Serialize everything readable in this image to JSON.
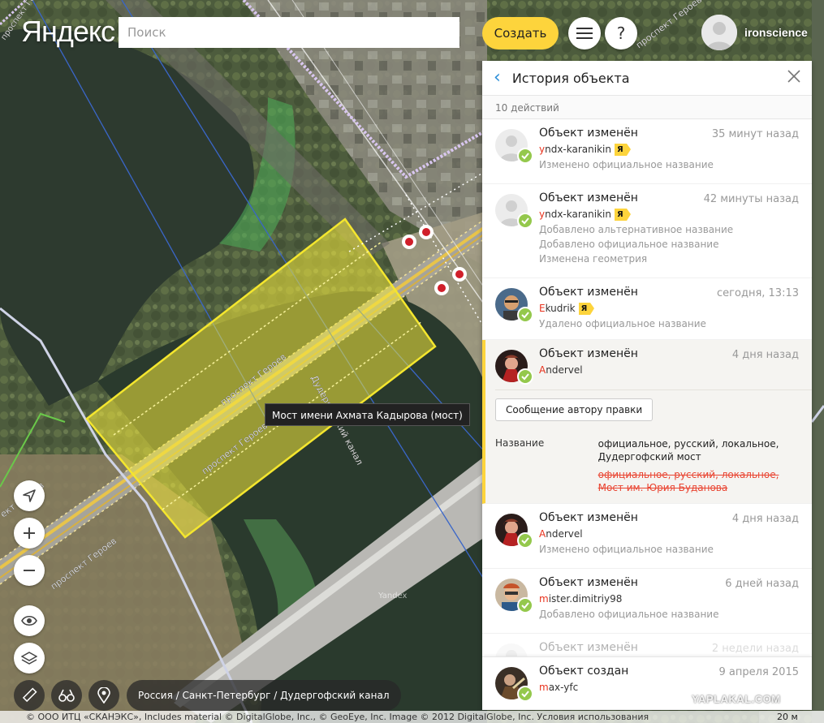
{
  "header": {
    "logo": "Яндекс",
    "search_placeholder": "Поиск",
    "create_label": "Создать",
    "help_label": "?",
    "username": "ironscience"
  },
  "map": {
    "tooltip": "Мост имени Ахмата Кадырова (мост)",
    "street_labels": [
      "проспект Героев",
      "проспект Героев",
      "проспект Героев",
      "проспект Героев",
      "ект Героев",
      "Дудергофский канал",
      "проспект Героев"
    ],
    "yandex_watermark": "Yandex",
    "breadcrumbs": "Россия / Санкт-Петербург / Дудергофский канал",
    "copyright": "© ООО ИТЦ «СКАНЭКС», Includes material © DigitalGlobe, Inc., © GeoEye, Inc. Image © 2012 DigitalGlobe, Inc. Условия использования",
    "scale": "20 м",
    "site_watermark": "YAPLAKAL.COM",
    "icons": [
      "locate-icon",
      "zoom-in-icon",
      "zoom-out-icon",
      "eye-icon",
      "layers-icon",
      "ruler-icon",
      "binoculars-icon",
      "pin-icon"
    ]
  },
  "panel": {
    "title": "История объекта",
    "count": "10 действий",
    "message_button": "Сообщение автору правки",
    "entries": [
      {
        "title": "Объект изменён",
        "time": "35 минут назад",
        "user_first": "y",
        "user_rest": "ndx-karanikin",
        "badge": "Я",
        "notes": [
          "Изменено официальное название"
        ]
      },
      {
        "title": "Объект изменён",
        "time": "42 минуты назад",
        "user_first": "y",
        "user_rest": "ndx-karanikin",
        "badge": "Я",
        "notes": [
          "Добавлено альтернативное название",
          "Добавлено официальное название",
          "Изменена геометрия"
        ]
      },
      {
        "title": "Объект изменён",
        "time": "сегодня, 13:13",
        "user_first": "E",
        "user_rest": "kudrik",
        "badge": "Я",
        "notes": [
          "Удалено официальное название"
        ]
      },
      {
        "title": "Объект изменён",
        "time": "4 дня назад",
        "user_first": "A",
        "user_rest": "ndervel",
        "diff_label": "Название",
        "diff_new": "официальное, русский, локальное, Дудергофский мост",
        "diff_old": "официальное, русский, локальное, Мост им. Юрия Буданова"
      },
      {
        "title": "Объект изменён",
        "time": "4 дня назад",
        "user_first": "A",
        "user_rest": "ndervel",
        "notes": [
          "Изменено официальное название"
        ]
      },
      {
        "title": "Объект изменён",
        "time": "6 дней назад",
        "user_first": "m",
        "user_rest": "ister.dimitriy98",
        "notes": [
          "Добавлено официальное название"
        ]
      },
      {
        "title": "Объект изменён",
        "time": "2 недели назад"
      },
      {
        "title": "Объект создан",
        "time": "9 апреля 2015",
        "user_first": "m",
        "user_rest": "ax-yfc"
      }
    ]
  }
}
